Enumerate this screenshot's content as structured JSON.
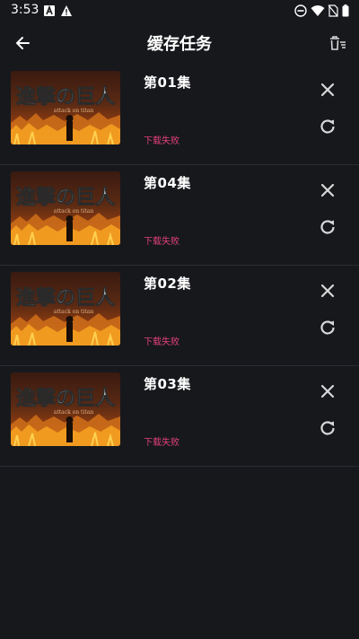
{
  "status_bar": {
    "time": "3:53",
    "icons": [
      "text-a-notification-icon",
      "warning-notification-icon",
      "do-not-disturb-icon",
      "wifi-icon",
      "no-sim-icon",
      "battery-icon"
    ]
  },
  "app_bar": {
    "title": "缓存任务",
    "back_icon": "arrow-left-icon",
    "clear_icon": "clear-all-icon"
  },
  "tasks": [
    {
      "title": "第01集",
      "status": "下载失败"
    },
    {
      "title": "第04集",
      "status": "下载失败"
    },
    {
      "title": "第02集",
      "status": "下载失败"
    },
    {
      "title": "第03集",
      "status": "下载失败"
    }
  ],
  "colors": {
    "background": "#17181c",
    "divider": "#2a2c31",
    "text_primary": "#ffffff",
    "status_error": "#e0407a",
    "icon": "#d8d8d8"
  }
}
